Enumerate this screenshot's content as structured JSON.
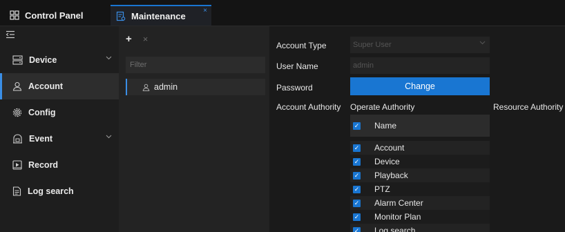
{
  "tabs": {
    "control_panel": "Control Panel",
    "maintenance": "Maintenance",
    "close_symbol": "×"
  },
  "sidebar": {
    "items": [
      {
        "label": "Device",
        "icon": "device-icon",
        "has_chevron": true
      },
      {
        "label": "Account",
        "icon": "account-icon",
        "active": true
      },
      {
        "label": "Config",
        "icon": "gear-icon"
      },
      {
        "label": "Event",
        "icon": "event-icon",
        "has_chevron": true
      },
      {
        "label": "Record",
        "icon": "record-icon"
      },
      {
        "label": "Log search",
        "icon": "document-icon"
      }
    ]
  },
  "account_list": {
    "add_symbol": "+",
    "delete_symbol": "×",
    "filter_placeholder": "Filter",
    "users": [
      "admin"
    ]
  },
  "form": {
    "account_type_label": "Account Type",
    "account_type_value": "Super User",
    "user_name_label": "User Name",
    "user_name_value": "admin",
    "password_label": "Password",
    "change_button": "Change",
    "account_authority_label": "Account Authority",
    "operate_authority_label": "Operate Authority",
    "resource_authority_label": "Resource Authority"
  },
  "authority_table": {
    "header": "Name",
    "rows": [
      "Account",
      "Device",
      "Playback",
      "PTZ",
      "Alarm Center",
      "Monitor Plan",
      "Log search"
    ]
  },
  "colors": {
    "accent": "#1976d2",
    "sidebar_bg": "#1e1e1e",
    "panel_bg": "#1a1a1a"
  }
}
